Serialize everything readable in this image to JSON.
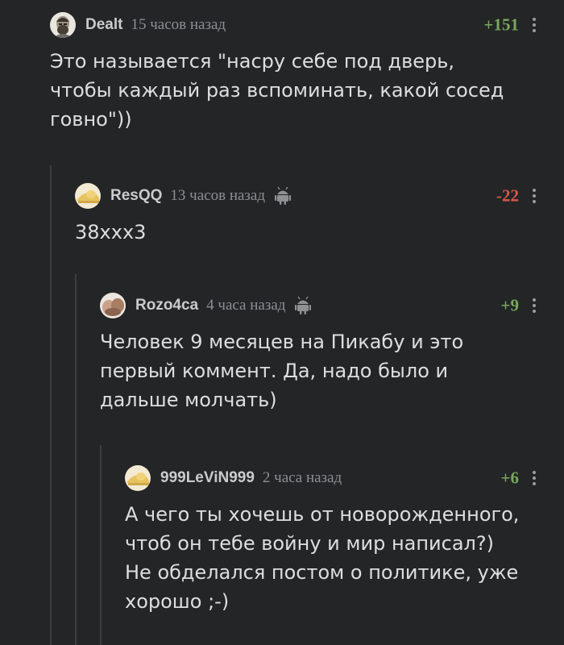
{
  "comments": [
    {
      "username": "Dealt",
      "time": "15 часов назад",
      "rating": "+151",
      "text": "Это называется \"насру себе под дверь,\nчтобы каждый раз вспоминать, какой сосед\nговно\"))"
    },
    {
      "username": "ResQQ",
      "time": "13 часов назад",
      "rating": "-22",
      "text": "38xxx3"
    },
    {
      "username": "Rozo4ca",
      "time": "4 часа назад",
      "rating": "+9",
      "text": "Человек 9 месяцев на Пикабу и это\nпервый коммент. Да, надо было и\nдальше молчать)"
    },
    {
      "username": "999LeViN999",
      "time": "2 часа назад",
      "rating": "+6",
      "text": "А чего ты хочешь от новорожденного,\nчтоб он тебе войну и мир написал?)\nНе обделался постом о политике, уже\nхорошо ;-)"
    }
  ],
  "colors": {
    "background": "#232527",
    "positive": "#7aa85a",
    "negative": "#d85a4a",
    "thread_line": "#3b3e41"
  },
  "icons": {
    "device": "android-icon",
    "menu": "more-vertical-icon"
  }
}
